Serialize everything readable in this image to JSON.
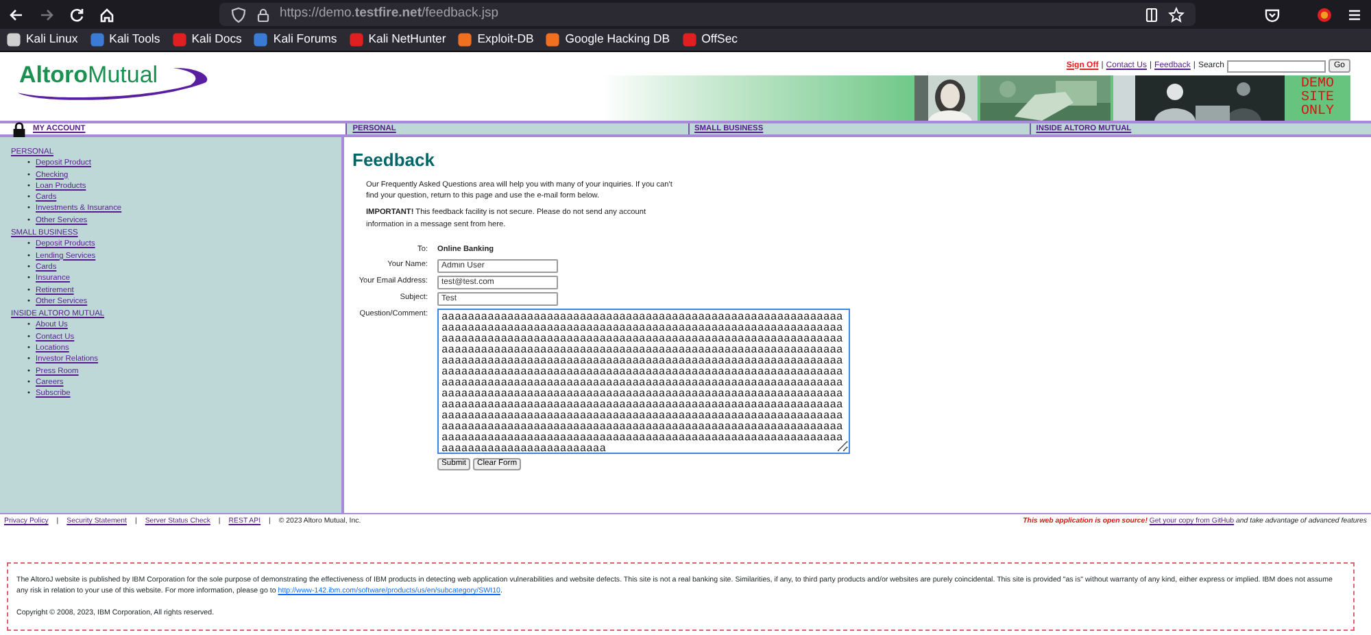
{
  "browser": {
    "url": "https://demo.**testfire.net**/feedback.jsp",
    "back_disabled": false,
    "forward_disabled": true,
    "bookmarks": [
      {
        "label": "Kali Linux",
        "color": "#cfcfcf"
      },
      {
        "label": "Kali Tools",
        "color": "#3a7bd5"
      },
      {
        "label": "Kali Docs",
        "color": "#e02020"
      },
      {
        "label": "Kali Forums",
        "color": "#3a7bd5"
      },
      {
        "label": "Kali NetHunter",
        "color": "#e02020"
      },
      {
        "label": "Exploit-DB",
        "color": "#f07020"
      },
      {
        "label": "Google Hacking DB",
        "color": "#f07020"
      },
      {
        "label": "OffSec",
        "color": "#e02020"
      }
    ]
  },
  "header": {
    "logo_bold": "Altoro",
    "logo_light": "Mutual",
    "top_links": [
      {
        "label": "Sign Off",
        "kind": "alert"
      },
      {
        "label": "Contact Us",
        "kind": "link"
      },
      {
        "label": "Feedback",
        "kind": "link"
      }
    ],
    "separator": "|",
    "search_label": "Search",
    "search_button": "Go",
    "banner_lines": [
      "DEMO",
      "SITE",
      "ONLY"
    ]
  },
  "tabs": [
    {
      "label": "MY ACCOUNT",
      "selected": true
    },
    {
      "label": "PERSONAL",
      "selected": false
    },
    {
      "label": "SMALL BUSINESS",
      "selected": false
    },
    {
      "label": "INSIDE ALTORO MUTUAL",
      "selected": false
    }
  ],
  "sidebar": {
    "bullet": "•",
    "sections": [
      {
        "label": "PERSONAL",
        "children": [
          "Deposit Product",
          "Checking",
          "Loan Products",
          "Cards",
          "Investments & Insurance",
          "Other Services"
        ]
      },
      {
        "label": "SMALL BUSINESS",
        "children": [
          "Deposit Products",
          "Lending Services",
          "Cards",
          "Insurance",
          "Retirement",
          "Other Services"
        ]
      },
      {
        "label": "INSIDE ALTORO MUTUAL",
        "children": [
          "About Us",
          "Contact Us",
          "Locations",
          "Investor Relations",
          "Press Room",
          "Careers",
          "Subscribe"
        ]
      }
    ]
  },
  "content": {
    "title": "Feedback",
    "paragraphs": [
      "Our Frequently Asked Questions area will help you with many of your inquiries. If you can't find your question, return to this page and use the e-mail form below.",
      "**IMPORTANT!** This feedback facility is not secure. Please do not send any account information in a message sent from here."
    ],
    "form": {
      "to_label": "To:",
      "to_value": "Online Banking",
      "fields": [
        {
          "label": "Your Name:",
          "value": "Admin User"
        },
        {
          "label": "Your Email Address:",
          "value": "test@test.com"
        },
        {
          "label": "Subject:",
          "value": "Test"
        }
      ],
      "comment_label": "Question/Comment:",
      "comment_focused": true,
      "comment_value": "aaaaaaaaaaaaaaaaaaaaaaaaaaaaaaaaaaaaaaaaaaaaaaaaaaaaaaaaaaaaaaaaaaaaaaaaaaaaaaaaaaaaaaaaaaaaaaaaaaaaaaaaaaaaaaaaaaaaaaaaaaaaaaaaaaaaaaaaaaaaaaaaaaaaaaaaaaaaaaaaaaaaaaaaaaaaaaaaaaaaaaaaaaaaaaaaaaaaaaaaaaaaaaaaaaaaaaaaaaaaaaaaaaaaaaaaaaaaaaaaaaaaaaaaaaaaaaaaaaaaaaaaaaaaaaaaaaaaaaaaaaaaaaaaaaaaaaaaaaaaaaaaaaaaaaaaaaaaaaaaaaaaaaaaaaaaaaaaaaaaaaaaaaaaaaaaaaaaaaaaaaaaaaaaaaaaaaaaaaaaaaaaaaaaaaaaaaaaaaaaaaaaaaaaaaaaaaaaaaaaaaaaaaaaaaaaaaaaaaaaaaaaaaaaaaaaaaaaaaaaaaaaaaaaaaaaaaaaaaaaaaaaaaaaaaaaaaaaaaaaaaaaaaaaaaaaaaaaaaaaaaaaaaaaaaaaaaaaaaaaaaaaaaaaaaaaaaaaaaaaaaaaaaaaaaaaaaaaaaaaaaaaaaaaaaaaaaaaaaaaaaaaaaaaaaaaaaaaaaaaaaaaaaaaaaaaaaaaaaaaaaaaaaaaaaaaaaaaaaaaaaaaaaaaaaaaaaaaaaaaaaaaaaaaaaaaaaaaaaaaaaaaaaaaaaaaaaaaaaaaaaaaaaaaaaaaaaaaaaaaaaaaaaaaaaaaaaaaa",
      "buttons": [
        "Submit",
        "Clear Form"
      ]
    }
  },
  "footer": {
    "separator": "|",
    "links": [
      "Privacy Policy",
      "Security Statement",
      "Server Status Check",
      "REST API"
    ],
    "copyright": "© 2023 Altoro Mutual, Inc.",
    "open_source": {
      "lead": "This web application is open source!",
      "link": "Get your copy from GitHub",
      "tail": "and take advantage of advanced features"
    }
  },
  "disclaimer": {
    "text": "The AltoroJ website is published by IBM Corporation for the sole purpose of demonstrating the effectiveness of IBM products in detecting web application vulnerabilities and website defects. This site is not a real banking site. Similarities, if any, to third party products and/or websites are purely coincidental. This site is provided \"as is\" without warranty of any kind, either express or implied. IBM does not assume any risk in relation to your use of this website. For more information, please go to",
    "link": "http://www-142.ibm.com/software/products/us/en/subcategory/SWI10",
    "tail": ".",
    "copyright": "Copyright © 2008, 2023, IBM Corporation, All rights reserved."
  }
}
